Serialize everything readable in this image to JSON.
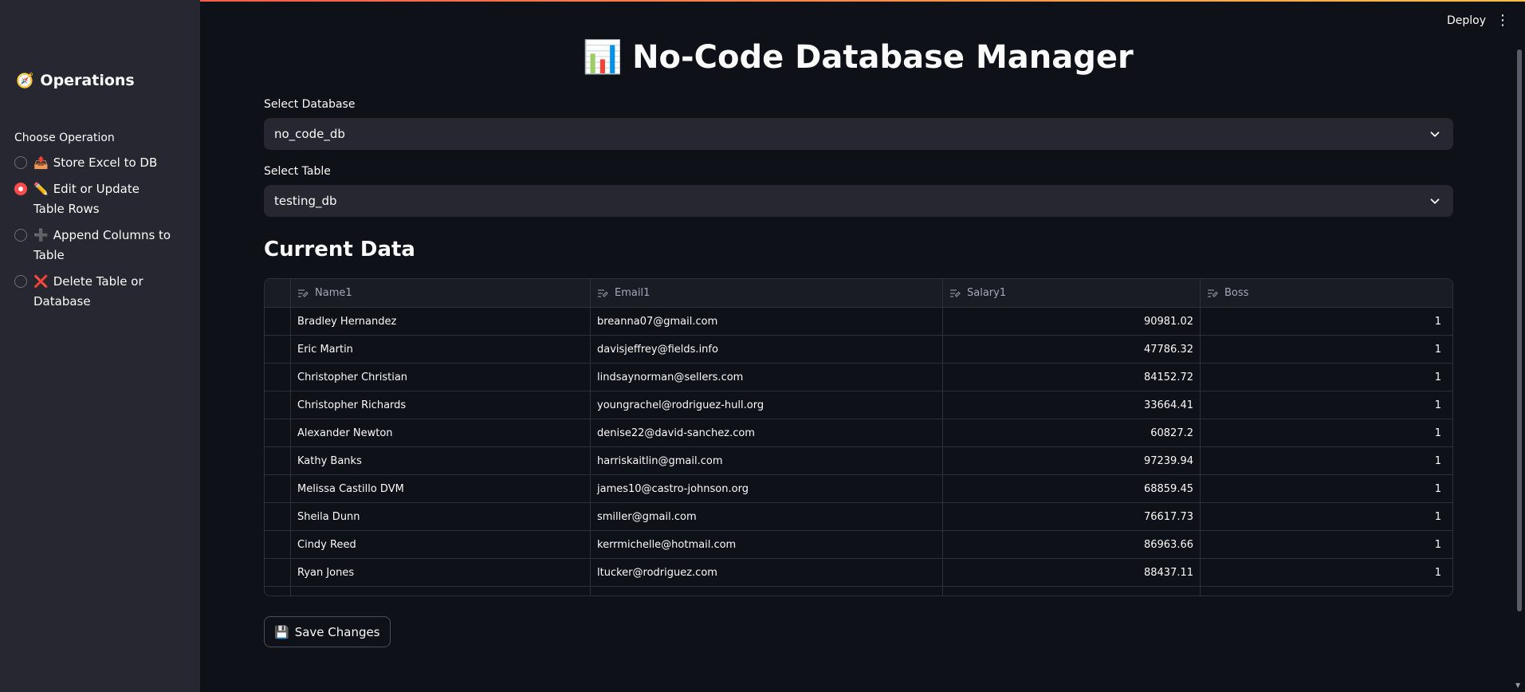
{
  "header": {
    "deploy_label": "Deploy",
    "menu_icon": "kebab-menu-icon"
  },
  "sidebar": {
    "title": "Operations",
    "title_icon": "🧭",
    "radio_label": "Choose Operation",
    "options": [
      {
        "emoji": "📤",
        "label": "Store Excel to DB",
        "selected": false
      },
      {
        "emoji": "✏️",
        "label": "Edit or Update Table Rows",
        "selected": true
      },
      {
        "emoji": "➕",
        "label": "Append Columns to Table",
        "selected": false
      },
      {
        "emoji": "❌",
        "label": "Delete Table or Database",
        "selected": false
      }
    ]
  },
  "main": {
    "title": "No-Code Database Manager",
    "title_icon": "📊",
    "db_label": "Select Database",
    "db_value": "no_code_db",
    "table_label": "Select Table",
    "table_value": "testing_db",
    "section_title": "Current Data",
    "save_label": "Save Changes",
    "save_icon": "💾"
  },
  "table": {
    "columns": [
      "Name1",
      "Email1",
      "Salary1",
      "Boss"
    ],
    "rows": [
      [
        "Bradley Hernandez",
        "breanna07@gmail.com",
        "90981.02",
        "1"
      ],
      [
        "Eric Martin",
        "davisjeffrey@fields.info",
        "47786.32",
        "1"
      ],
      [
        "Christopher Christian",
        "lindsaynorman@sellers.com",
        "84152.72",
        "1"
      ],
      [
        "Christopher Richards",
        "youngrachel@rodriguez-hull.org",
        "33664.41",
        "1"
      ],
      [
        "Alexander Newton",
        "denise22@david-sanchez.com",
        "60827.2",
        "1"
      ],
      [
        "Kathy Banks",
        "harriskaitlin@gmail.com",
        "97239.94",
        "1"
      ],
      [
        "Melissa Castillo DVM",
        "james10@castro-johnson.org",
        "68859.45",
        "1"
      ],
      [
        "Sheila Dunn",
        "smiller@gmail.com",
        "76617.73",
        "1"
      ],
      [
        "Cindy Reed",
        "kerrmichelle@hotmail.com",
        "86963.66",
        "1"
      ],
      [
        "Ryan Jones",
        "ltucker@rodriguez.com",
        "88437.11",
        "1"
      ]
    ]
  },
  "colors": {
    "accent": "#ff4b4b",
    "background": "#0e1117",
    "sidebar": "#262730"
  }
}
